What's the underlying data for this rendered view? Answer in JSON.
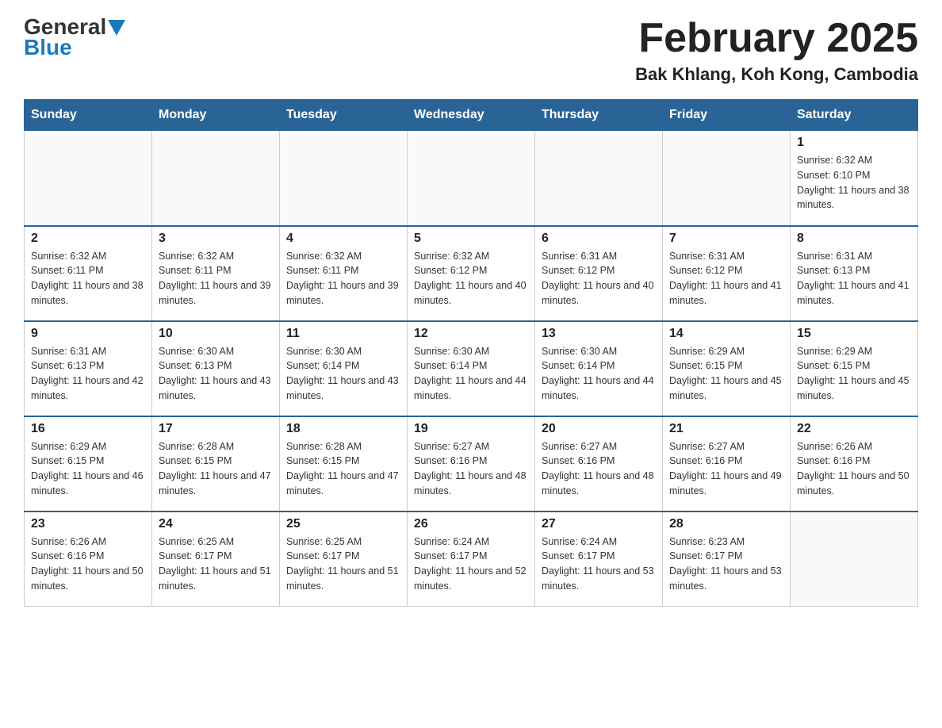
{
  "header": {
    "logo_general": "General",
    "logo_blue": "Blue",
    "title": "February 2025",
    "subtitle": "Bak Khlang, Koh Kong, Cambodia"
  },
  "days_of_week": [
    "Sunday",
    "Monday",
    "Tuesday",
    "Wednesday",
    "Thursday",
    "Friday",
    "Saturday"
  ],
  "weeks": [
    [
      {
        "day": "",
        "info": ""
      },
      {
        "day": "",
        "info": ""
      },
      {
        "day": "",
        "info": ""
      },
      {
        "day": "",
        "info": ""
      },
      {
        "day": "",
        "info": ""
      },
      {
        "day": "",
        "info": ""
      },
      {
        "day": "1",
        "info": "Sunrise: 6:32 AM\nSunset: 6:10 PM\nDaylight: 11 hours and 38 minutes."
      }
    ],
    [
      {
        "day": "2",
        "info": "Sunrise: 6:32 AM\nSunset: 6:11 PM\nDaylight: 11 hours and 38 minutes."
      },
      {
        "day": "3",
        "info": "Sunrise: 6:32 AM\nSunset: 6:11 PM\nDaylight: 11 hours and 39 minutes."
      },
      {
        "day": "4",
        "info": "Sunrise: 6:32 AM\nSunset: 6:11 PM\nDaylight: 11 hours and 39 minutes."
      },
      {
        "day": "5",
        "info": "Sunrise: 6:32 AM\nSunset: 6:12 PM\nDaylight: 11 hours and 40 minutes."
      },
      {
        "day": "6",
        "info": "Sunrise: 6:31 AM\nSunset: 6:12 PM\nDaylight: 11 hours and 40 minutes."
      },
      {
        "day": "7",
        "info": "Sunrise: 6:31 AM\nSunset: 6:12 PM\nDaylight: 11 hours and 41 minutes."
      },
      {
        "day": "8",
        "info": "Sunrise: 6:31 AM\nSunset: 6:13 PM\nDaylight: 11 hours and 41 minutes."
      }
    ],
    [
      {
        "day": "9",
        "info": "Sunrise: 6:31 AM\nSunset: 6:13 PM\nDaylight: 11 hours and 42 minutes."
      },
      {
        "day": "10",
        "info": "Sunrise: 6:30 AM\nSunset: 6:13 PM\nDaylight: 11 hours and 43 minutes."
      },
      {
        "day": "11",
        "info": "Sunrise: 6:30 AM\nSunset: 6:14 PM\nDaylight: 11 hours and 43 minutes."
      },
      {
        "day": "12",
        "info": "Sunrise: 6:30 AM\nSunset: 6:14 PM\nDaylight: 11 hours and 44 minutes."
      },
      {
        "day": "13",
        "info": "Sunrise: 6:30 AM\nSunset: 6:14 PM\nDaylight: 11 hours and 44 minutes."
      },
      {
        "day": "14",
        "info": "Sunrise: 6:29 AM\nSunset: 6:15 PM\nDaylight: 11 hours and 45 minutes."
      },
      {
        "day": "15",
        "info": "Sunrise: 6:29 AM\nSunset: 6:15 PM\nDaylight: 11 hours and 45 minutes."
      }
    ],
    [
      {
        "day": "16",
        "info": "Sunrise: 6:29 AM\nSunset: 6:15 PM\nDaylight: 11 hours and 46 minutes."
      },
      {
        "day": "17",
        "info": "Sunrise: 6:28 AM\nSunset: 6:15 PM\nDaylight: 11 hours and 47 minutes."
      },
      {
        "day": "18",
        "info": "Sunrise: 6:28 AM\nSunset: 6:15 PM\nDaylight: 11 hours and 47 minutes."
      },
      {
        "day": "19",
        "info": "Sunrise: 6:27 AM\nSunset: 6:16 PM\nDaylight: 11 hours and 48 minutes."
      },
      {
        "day": "20",
        "info": "Sunrise: 6:27 AM\nSunset: 6:16 PM\nDaylight: 11 hours and 48 minutes."
      },
      {
        "day": "21",
        "info": "Sunrise: 6:27 AM\nSunset: 6:16 PM\nDaylight: 11 hours and 49 minutes."
      },
      {
        "day": "22",
        "info": "Sunrise: 6:26 AM\nSunset: 6:16 PM\nDaylight: 11 hours and 50 minutes."
      }
    ],
    [
      {
        "day": "23",
        "info": "Sunrise: 6:26 AM\nSunset: 6:16 PM\nDaylight: 11 hours and 50 minutes."
      },
      {
        "day": "24",
        "info": "Sunrise: 6:25 AM\nSunset: 6:17 PM\nDaylight: 11 hours and 51 minutes."
      },
      {
        "day": "25",
        "info": "Sunrise: 6:25 AM\nSunset: 6:17 PM\nDaylight: 11 hours and 51 minutes."
      },
      {
        "day": "26",
        "info": "Sunrise: 6:24 AM\nSunset: 6:17 PM\nDaylight: 11 hours and 52 minutes."
      },
      {
        "day": "27",
        "info": "Sunrise: 6:24 AM\nSunset: 6:17 PM\nDaylight: 11 hours and 53 minutes."
      },
      {
        "day": "28",
        "info": "Sunrise: 6:23 AM\nSunset: 6:17 PM\nDaylight: 11 hours and 53 minutes."
      },
      {
        "day": "",
        "info": ""
      }
    ]
  ]
}
